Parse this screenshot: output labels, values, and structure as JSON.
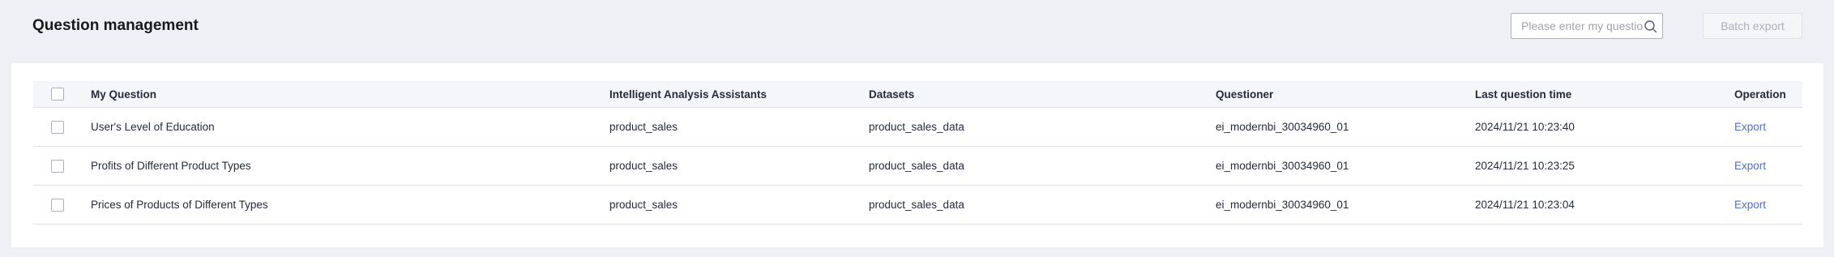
{
  "page": {
    "title": "Question management"
  },
  "search": {
    "placeholder": "Please enter my question",
    "value": ""
  },
  "toolbar": {
    "batch_export_label": "Batch export"
  },
  "table": {
    "columns": {
      "question": "My Question",
      "assistant": "Intelligent Analysis Assistants",
      "dataset": "Datasets",
      "questioner": "Questioner",
      "time": "Last question time",
      "operation": "Operation"
    },
    "rows": [
      {
        "question": "User's Level of Education",
        "assistant": "product_sales",
        "dataset": "product_sales_data",
        "questioner": "ei_modernbi_30034960_01",
        "time": "2024/11/21 10:23:40",
        "operation": "Export"
      },
      {
        "question": "Profits of Different Product Types",
        "assistant": "product_sales",
        "dataset": "product_sales_data",
        "questioner": "ei_modernbi_30034960_01",
        "time": "2024/11/21 10:23:25",
        "operation": "Export"
      },
      {
        "question": "Prices of Products of Different Types",
        "assistant": "product_sales",
        "dataset": "product_sales_data",
        "questioner": "ei_modernbi_30034960_01",
        "time": "2024/11/21 10:23:04",
        "operation": "Export"
      }
    ]
  },
  "icons": {
    "search": "search-icon"
  },
  "colors": {
    "link": "#526ecc",
    "background": "#eef0f5",
    "header_row": "#f4f6fa"
  }
}
